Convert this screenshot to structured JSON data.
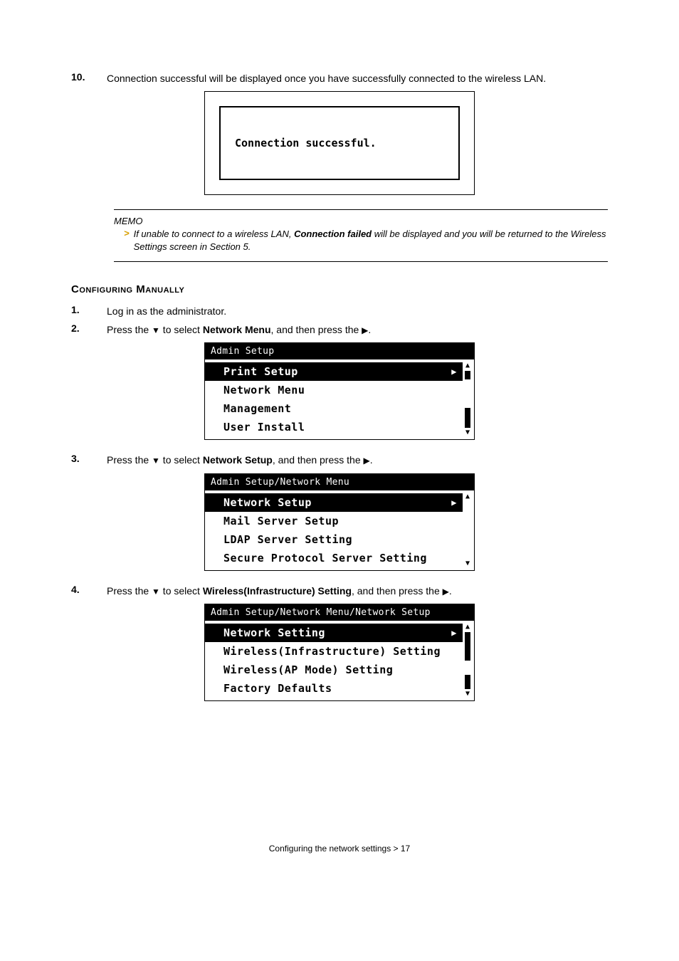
{
  "step10": {
    "num": "10.",
    "text": "Connection successful will be displayed once you have successfully connected to the wireless LAN."
  },
  "lcd_message": "Connection successful.",
  "memo": {
    "title": "MEMO",
    "arrow": ">",
    "text_pre": "If unable to connect to a wireless LAN, ",
    "text_bold": "Connection failed",
    "text_post": " will be displayed and you will be returned to the Wireless Settings screen in Section 5."
  },
  "heading": "Configuring Manually",
  "step1": {
    "num": "1.",
    "text": "Log in as the administrator."
  },
  "step2": {
    "num": "2.",
    "pre": "Press the ",
    "mid1": " to select ",
    "bold": "Network Menu",
    "mid2": ", and then press the ",
    "post": "."
  },
  "menu1": {
    "title": "Admin Setup",
    "items": [
      "Print Setup",
      "Network Menu",
      "Management",
      "User Install"
    ],
    "selected": 0
  },
  "step3": {
    "num": "3.",
    "pre": "Press the ",
    "mid1": " to select ",
    "bold": "Network Setup",
    "mid2": ", and then press the ",
    "post": "."
  },
  "menu2": {
    "title": "Admin Setup/Network Menu",
    "items": [
      "Network Setup",
      "Mail Server Setup",
      "LDAP Server Setting",
      "Secure Protocol Server Setting"
    ],
    "selected": 0
  },
  "step4": {
    "num": "4.",
    "pre": "Press the ",
    "mid1": " to select ",
    "bold": "Wireless(Infrastructure) Setting",
    "mid2": ", and then press the ",
    "post": "."
  },
  "menu3": {
    "title": "Admin Setup/Network Menu/Network Setup",
    "items": [
      "Network Setting",
      "Wireless(Infrastructure) Setting",
      "Wireless(AP Mode) Setting",
      "Factory Defaults"
    ],
    "selected": 0
  },
  "footer": "Configuring the network settings > 17"
}
